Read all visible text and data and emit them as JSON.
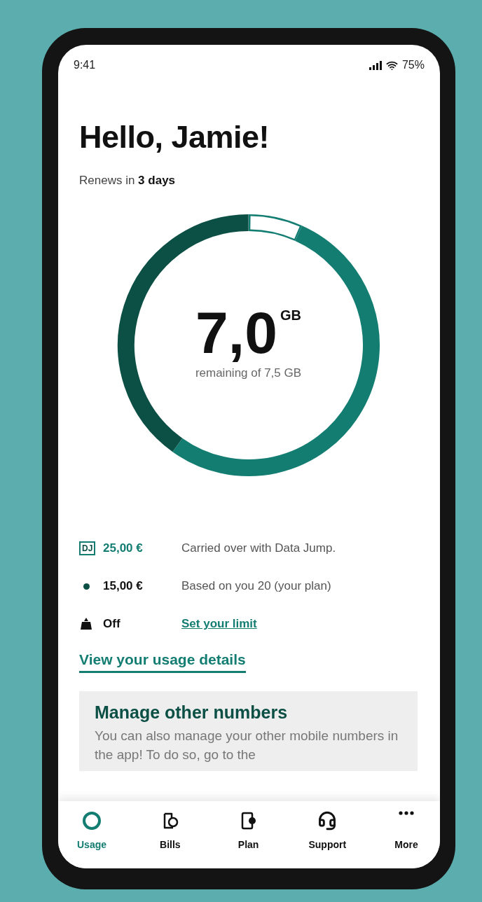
{
  "status_bar": {
    "time": "9:41",
    "battery": "75%"
  },
  "greeting": "Hello, Jamie!",
  "renewal": "Renews in **3 days**",
  "usage": {
    "amount": "7,0",
    "unit": "GB",
    "caption": "remaining of 7,5 GB"
  },
  "balances": [
    {
      "kind": "badge",
      "badge": "DJ",
      "amount": "25,00 €",
      "description": "Carried over with Data Jump."
    },
    {
      "kind": "dot",
      "amount": "15,00 €",
      "description": "Based on you 20 (your plan)"
    },
    {
      "kind": "limit",
      "status": "Off",
      "link": "Set your limit"
    }
  ],
  "details_link": "View your usage details",
  "card": {
    "title": "Manage other numbers",
    "body": "You can also manage your other mobile numbers in the app! To do so, go to the"
  },
  "nav": [
    {
      "label": "Usage",
      "selected": true
    },
    {
      "label": "Bills",
      "selected": false
    },
    {
      "label": "Plan",
      "selected": false
    },
    {
      "label": "Support",
      "selected": false
    },
    {
      "label": "More",
      "selected": false
    }
  ]
}
